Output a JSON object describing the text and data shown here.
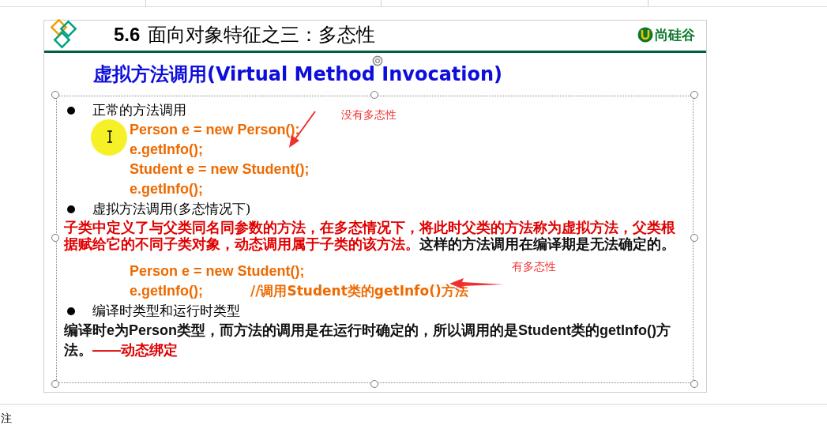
{
  "notes_pane": {
    "label": "注"
  },
  "slide": {
    "section_number": "5.6",
    "title": "面向对象特征之三：多态性",
    "brand": "尚硅谷",
    "subtitle": "虚拟方法调用(Virtual Method Invocation)",
    "content": [
      {
        "kind": "bullet",
        "text": "正常的方法调用"
      },
      {
        "kind": "code",
        "text": "Person e = new Person();"
      },
      {
        "kind": "code",
        "text": "e.getInfo();"
      },
      {
        "kind": "code",
        "text": "Student e = new Student();"
      },
      {
        "kind": "code",
        "text": "e.getInfo();"
      },
      {
        "kind": "bullet",
        "text": "虚拟方法调用(多态情况下)"
      },
      {
        "kind": "paragraph",
        "segments": [
          {
            "color": "#e00000",
            "text": "子类中定义了与父类同名同参数的方法，在多态情况下，将此时父类的方法称为虚拟方法，父类根据赋给它的不同子类对象，动态调用属于子类的该方法。"
          },
          {
            "color": "#111111",
            "text": "这样的方法调用在编译期是无法确定的。"
          }
        ]
      },
      {
        "kind": "gap"
      },
      {
        "kind": "code",
        "text": "Person e = new Student();"
      },
      {
        "kind": "code",
        "text": "e.getInfo();",
        "comment": "//调用Student类的getInfo()方法"
      },
      {
        "kind": "bullet",
        "text": "编译时类型和运行时类型"
      },
      {
        "kind": "paragraph",
        "segments": [
          {
            "color": "#111111",
            "text": "编译时**e**为**Person**类型，而方法的调用是在运行时确定的，所以调用的是**Student**类的**getInfo()**方法。"
          },
          {
            "color": "#e00000",
            "text": "——动态绑定"
          }
        ]
      }
    ],
    "annotations": [
      {
        "text": "没有多态性"
      },
      {
        "text": "有多态性"
      }
    ]
  }
}
